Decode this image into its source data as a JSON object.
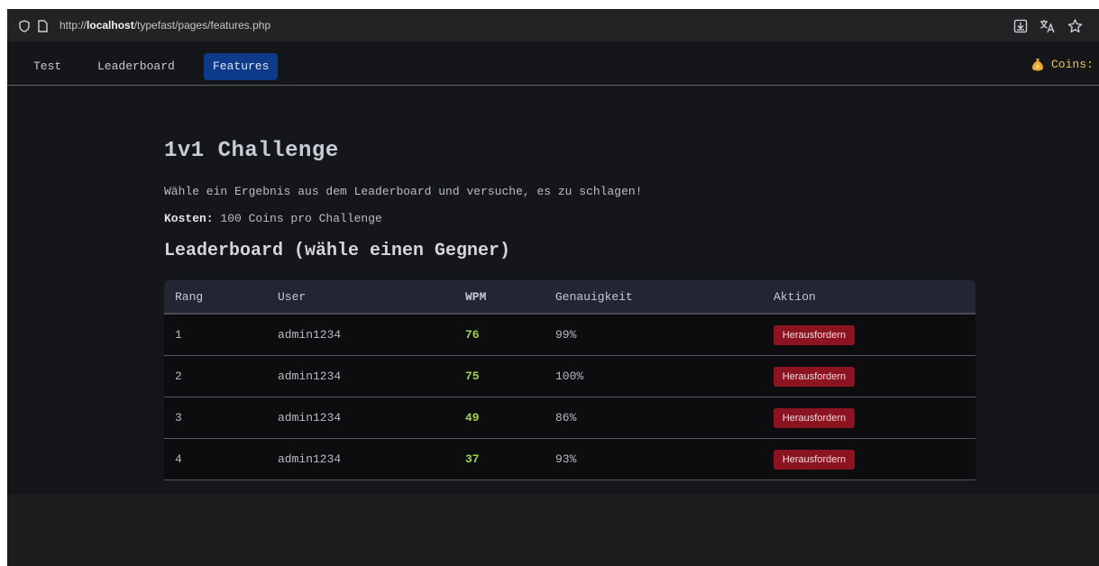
{
  "browser": {
    "url_prefix": "http://",
    "url_host": "localhost",
    "url_path": "/typefast/pages/features.php"
  },
  "nav": {
    "items": [
      {
        "label": "Test",
        "active": false
      },
      {
        "label": "Leaderboard",
        "active": false
      },
      {
        "label": "Features",
        "active": true
      }
    ],
    "coins_label": "Coins:"
  },
  "page": {
    "title": "1v1 Challenge",
    "description": "Wähle ein Ergebnis aus dem Leaderboard und versuche, es zu schlagen!",
    "cost_label": "Kosten:",
    "cost_value": " 100 Coins pro Challenge",
    "leaderboard_title": "Leaderboard (wähle einen Gegner)"
  },
  "table": {
    "headers": [
      "Rang",
      "User",
      "WPM",
      "Genauigkeit",
      "Aktion"
    ],
    "rows": [
      {
        "rang": "1",
        "user": "admin1234",
        "wpm": "76",
        "accuracy": "99%",
        "action": "Herausfordern"
      },
      {
        "rang": "2",
        "user": "admin1234",
        "wpm": "75",
        "accuracy": "100%",
        "action": "Herausfordern"
      },
      {
        "rang": "3",
        "user": "admin1234",
        "wpm": "49",
        "accuracy": "86%",
        "action": "Herausfordern"
      },
      {
        "rang": "4",
        "user": "admin1234",
        "wpm": "37",
        "accuracy": "93%",
        "action": "Herausfordern"
      }
    ]
  },
  "colors": {
    "accent": "#0e3a8a",
    "wpm": "#9fd34a",
    "challenge_button": "#8b1420",
    "coins": "#f0c14b"
  }
}
